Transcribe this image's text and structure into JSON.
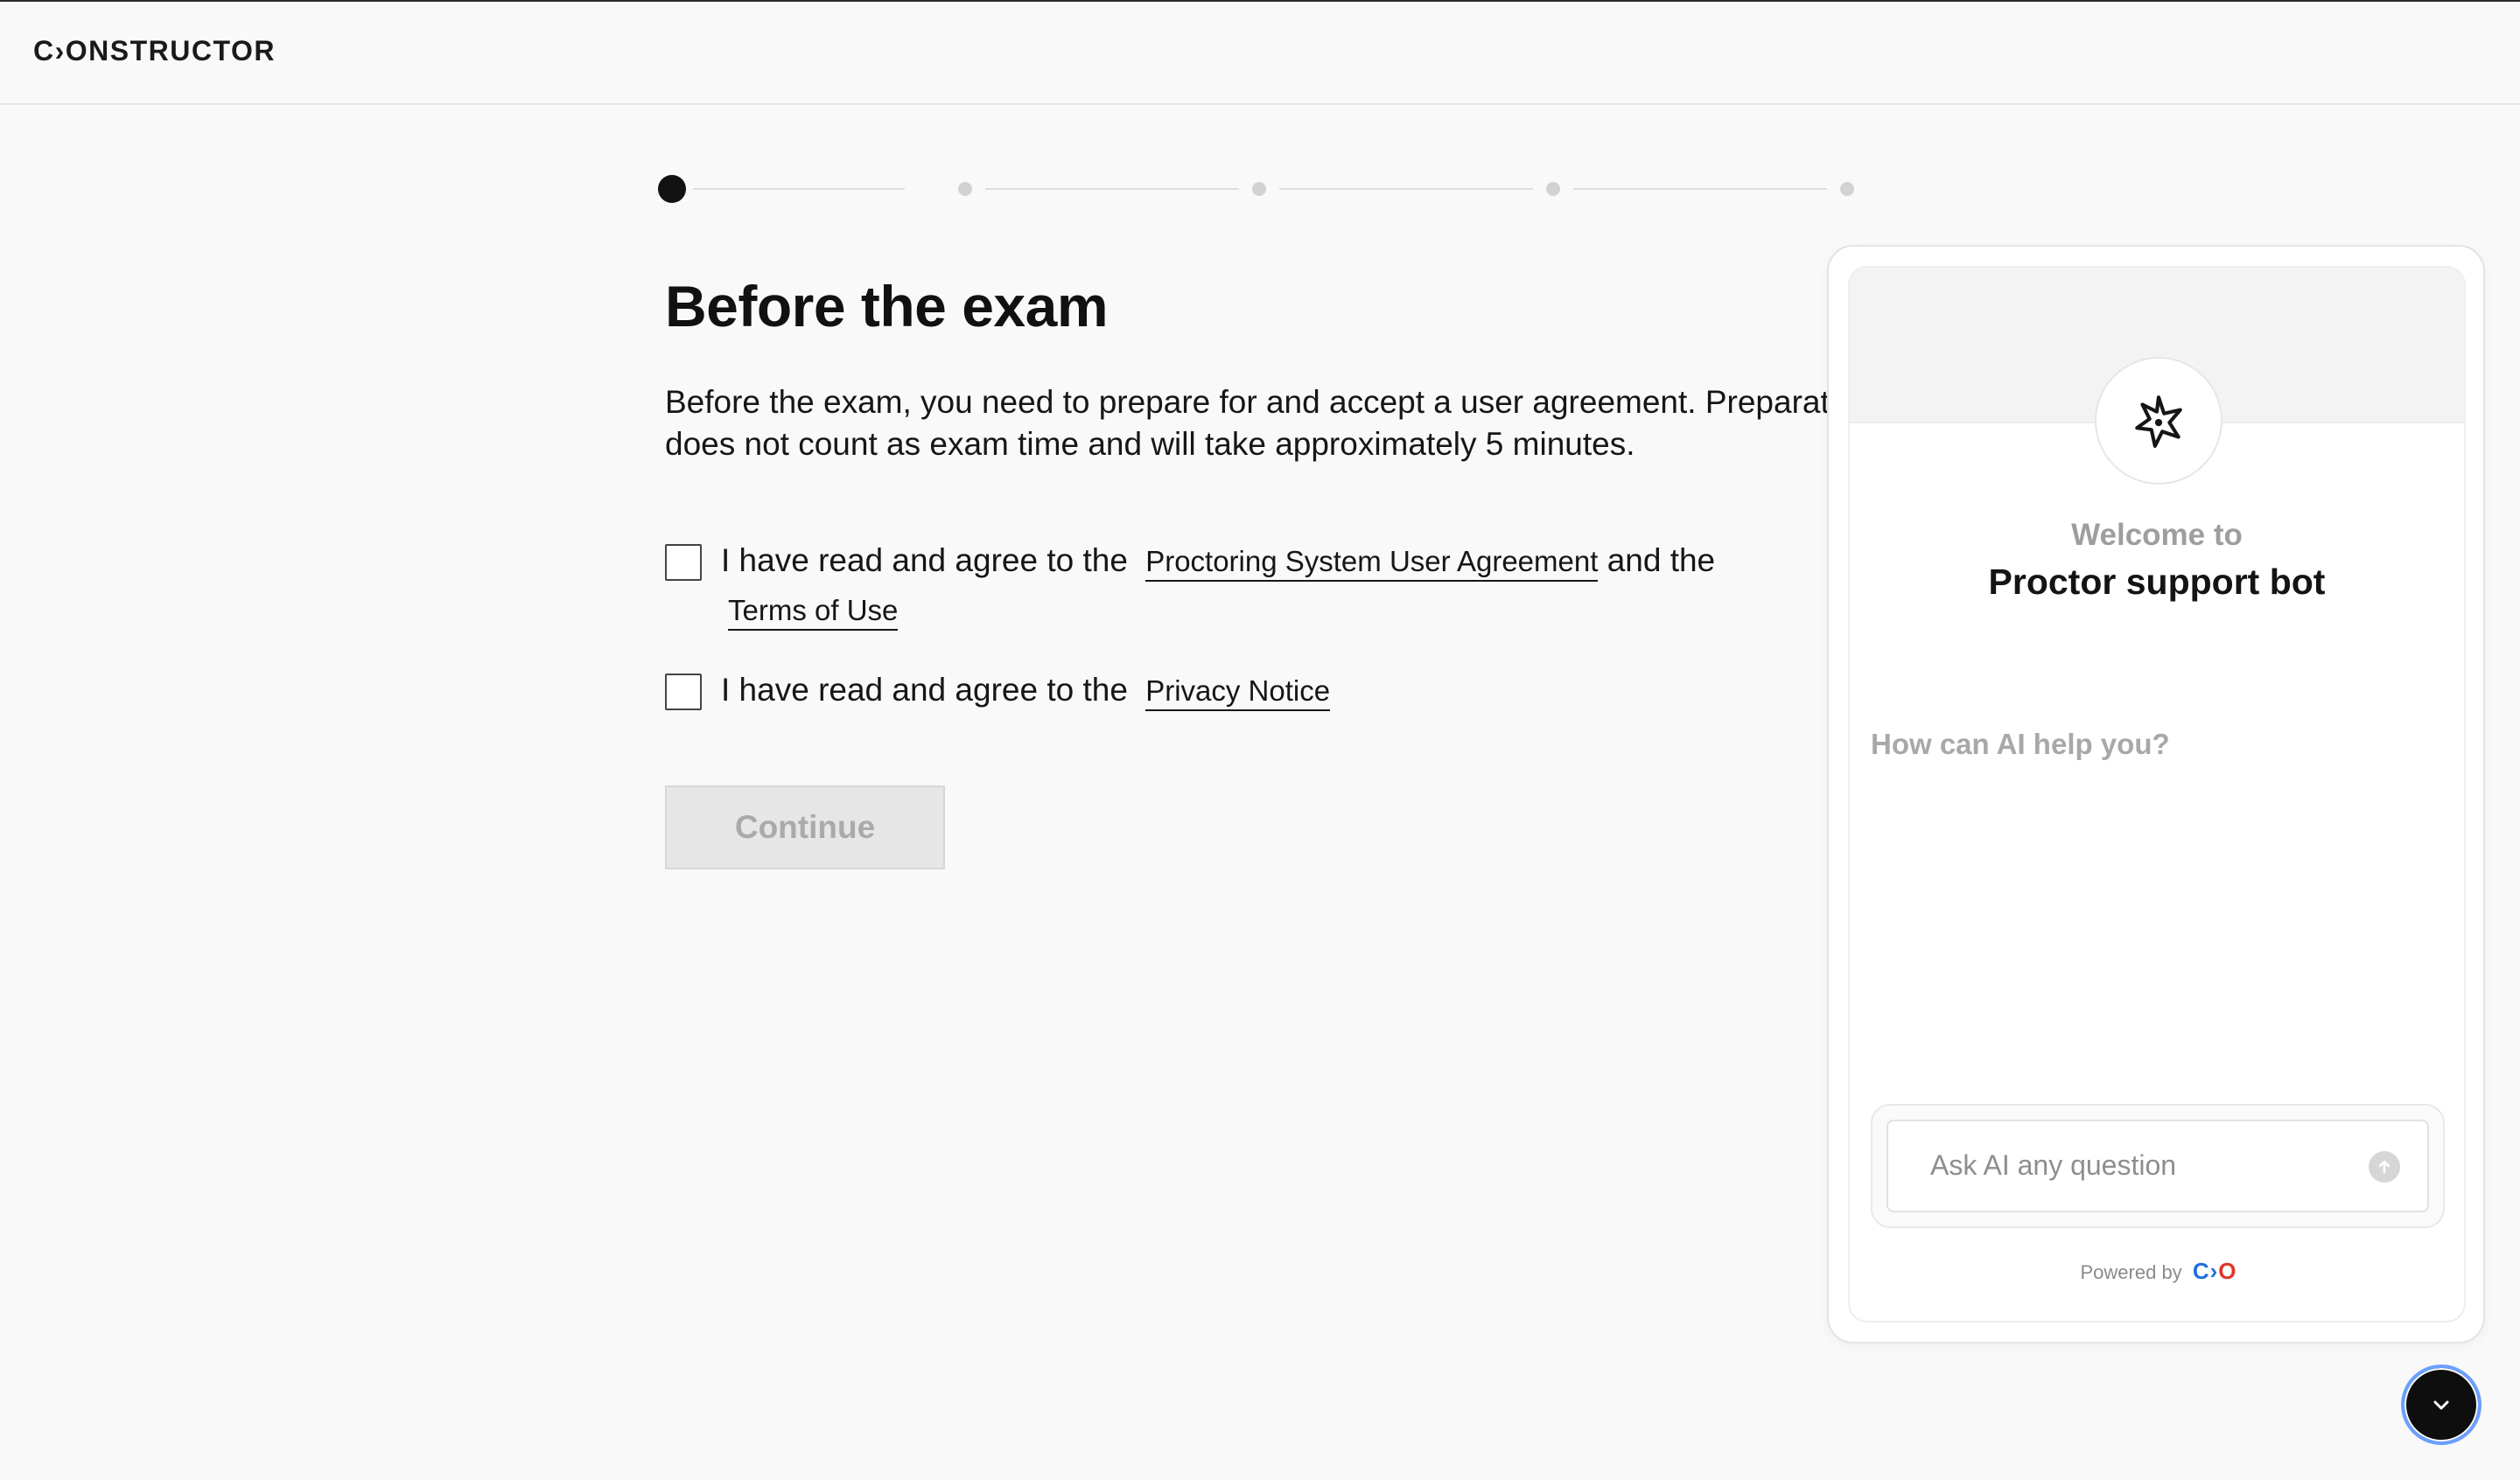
{
  "header": {
    "logo": "C›ONSTRUCTOR"
  },
  "stepper": {
    "current_step": 1,
    "total_steps": 5
  },
  "main": {
    "title": "Before the exam",
    "description_line1": "Before the exam, you need to prepare for and accept a user agreement. Preparation",
    "description_line2": "does not count as exam time and will take approximately 5 minutes.",
    "agreement1": {
      "prefix": "I have read and agree to the",
      "link1": "Proctoring System User Agreement",
      "middle": "and the",
      "link2": "Terms of Use",
      "checked": false
    },
    "agreement2": {
      "prefix": "I have read and agree to the",
      "link": "Privacy Notice",
      "checked": false
    },
    "continue_label": "Continue",
    "continue_disabled": true
  },
  "chat": {
    "welcome": "Welcome to",
    "bot_name": "Proctor support bot",
    "help_prompt": "How can AI help you?",
    "input_placeholder": "Ask AI any question",
    "powered_by": "Powered by",
    "powered_logo": "C›O",
    "toggle_icon": "chevron-down-icon",
    "avatar_icon": "sparkle-star-icon"
  },
  "colors": {
    "background": "#f9f9f9",
    "text": "#111111",
    "disabled_button": "#e6e6e6",
    "toggle_ring": "#6aa0ff",
    "powered_logo_blue": "#1f6fe0",
    "powered_logo_red": "#e0352b"
  }
}
